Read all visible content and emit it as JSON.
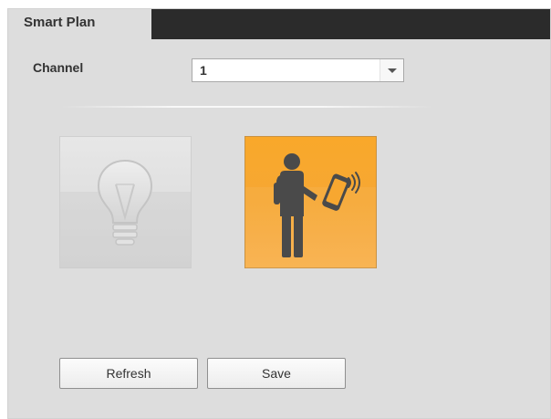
{
  "tab": {
    "label": "Smart Plan"
  },
  "channel": {
    "label": "Channel",
    "selected": "1"
  },
  "plans": [
    {
      "icon": "lightbulb-icon",
      "active": false,
      "color": "#e0e0e0"
    },
    {
      "icon": "person-phone-icon",
      "active": true,
      "color": "#f7a730"
    }
  ],
  "buttons": {
    "refresh_label": "Refresh",
    "save_label": "Save"
  }
}
